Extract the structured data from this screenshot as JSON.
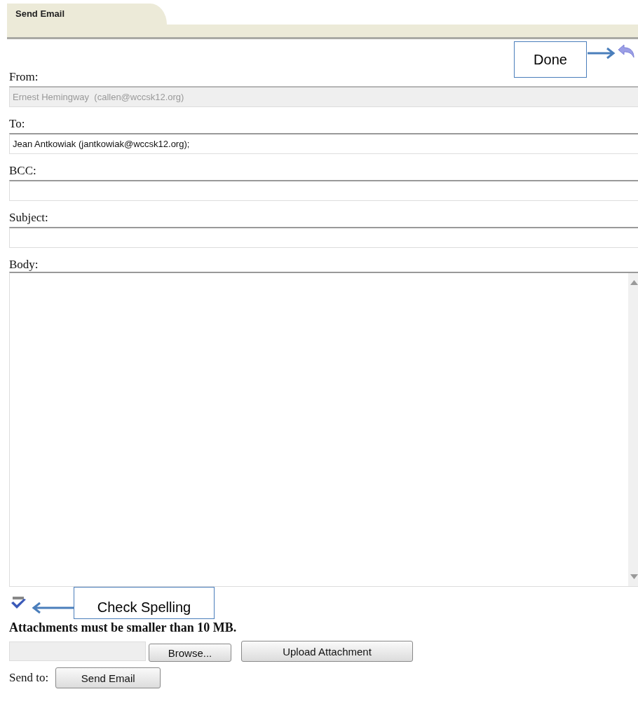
{
  "tab": {
    "label": "Send Email"
  },
  "done_callout": "Done",
  "fields": [
    {
      "label": "From:",
      "value": "Ernest Hemingway  (callen@wccsk12.org)",
      "disabled": true
    },
    {
      "label": "To:",
      "value": "Jean Antkowiak (jantkowiak@wccsk12.org);",
      "disabled": false
    },
    {
      "label": "BCC:",
      "disabled": false
    },
    {
      "label": "Subject:",
      "disabled": false
    }
  ],
  "body": {
    "label": "Body:"
  },
  "spell_callout": "Check Spelling",
  "attachment_note": "Attachments must be smaller than 10 MB.",
  "browse_button": "Browse...",
  "upload_button": "Upload Attachment",
  "send_label": "Send to:",
  "send_button": "Send Email"
}
